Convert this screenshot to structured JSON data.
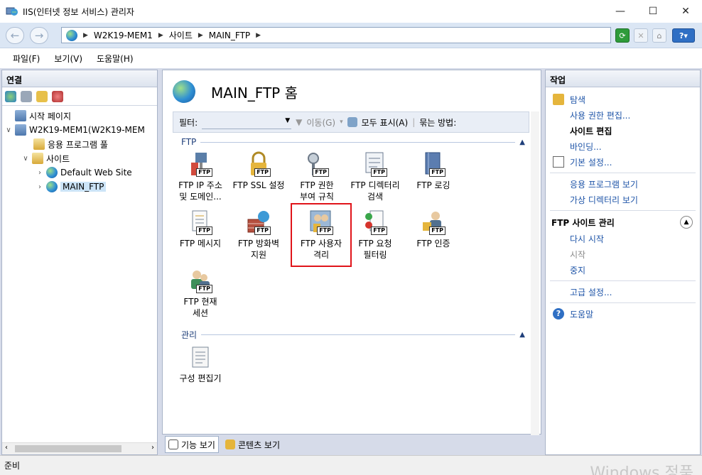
{
  "window": {
    "title": "IIS(인터넷 정보 서비스) 관리자",
    "min": "—",
    "max": "☐",
    "close": "✕"
  },
  "address": {
    "back": "←",
    "forward": "→",
    "crumbs": [
      "W2K19-MEM1",
      "사이트",
      "MAIN_FTP"
    ],
    "sep": "▶"
  },
  "menu": [
    "파일(F)",
    "보기(V)",
    "도움말(H)"
  ],
  "connections": {
    "header": "연결",
    "tree": [
      {
        "label": "시작 페이지"
      },
      {
        "label": "W2K19-MEM1(W2K19-MEM"
      },
      {
        "label": "응용 프로그램 풀"
      },
      {
        "label": "사이트"
      },
      {
        "label": "Default Web Site"
      },
      {
        "label": "MAIN_FTP"
      }
    ]
  },
  "center": {
    "title": "MAIN_FTP 홈",
    "filter_label": "필터:",
    "go": "이동(G)",
    "show_all": "모두 표시(A)",
    "group_by": "묶는 방법:",
    "groups": [
      {
        "name": "FTP",
        "collapse": "▲"
      },
      {
        "name": "관리",
        "collapse": "▲"
      }
    ],
    "features": [
      {
        "l1": "FTP IP 주소",
        "l2": "및 도메인..."
      },
      {
        "l1": "FTP SSL 설정",
        "l2": ""
      },
      {
        "l1": "FTP 권한",
        "l2": "부여 규칙"
      },
      {
        "l1": "FTP 디렉터리",
        "l2": "검색"
      },
      {
        "l1": "FTP 로깅",
        "l2": ""
      },
      {
        "l1": "FTP 메시지",
        "l2": ""
      },
      {
        "l1": "FTP 방화벽",
        "l2": "지원"
      },
      {
        "l1": "FTP 사용자",
        "l2": "격리"
      },
      {
        "l1": "FTP 요청",
        "l2": "필터링"
      },
      {
        "l1": "FTP 인증",
        "l2": ""
      },
      {
        "l1": "FTP 현재",
        "l2": "세션"
      },
      {
        "l1": "구성 편집기",
        "l2": ""
      }
    ],
    "ftp_badge": "FTP",
    "tabs": [
      "기능 보기",
      "콘텐츠 보기"
    ]
  },
  "actions": {
    "header": "작업",
    "explore": "탐색",
    "edit_perm": "사용 권한 편집...",
    "site_edit": "사이트 편집",
    "bindings": "바인딩...",
    "basic": "기본 설정...",
    "view_apps": "응용 프로그램 보기",
    "view_vdirs": "가상 디렉터리 보기",
    "ftp_manage": "FTP 사이트 관리",
    "restart": "다시 시작",
    "start": "시작",
    "stop": "중지",
    "advanced": "고급 설정...",
    "help": "도움말"
  },
  "status": {
    "text": "준비",
    "watermark": "Windows 정품"
  }
}
